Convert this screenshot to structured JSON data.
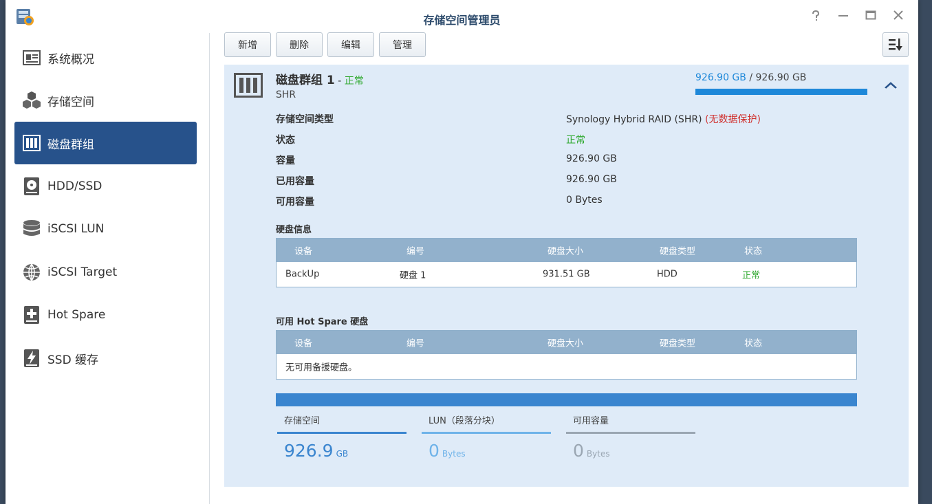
{
  "window": {
    "title": "存储空间管理员",
    "help_icon": "help-icon",
    "minimize_icon": "minimize-icon",
    "maximize_icon": "maximize-icon",
    "close_icon": "close-icon"
  },
  "sidebar": {
    "items": [
      {
        "label": "系统概况",
        "icon": "overview-icon"
      },
      {
        "label": "存储空间",
        "icon": "volume-cubes-icon"
      },
      {
        "label": "磁盘群组",
        "icon": "disk-group-icon",
        "active": true
      },
      {
        "label": "HDD/SSD",
        "icon": "hdd-icon"
      },
      {
        "label": "iSCSI LUN",
        "icon": "database-icon"
      },
      {
        "label": "iSCSI Target",
        "icon": "globe-icon"
      },
      {
        "label": "Hot Spare",
        "icon": "hot-spare-plus-icon"
      },
      {
        "label": "SSD 缓存",
        "icon": "ssd-cache-bolt-icon"
      }
    ]
  },
  "toolbar": {
    "create": "新增",
    "delete": "删除",
    "edit": "编辑",
    "manage": "管理",
    "sort_icon": "sort-icon"
  },
  "group": {
    "name": "磁盘群组 1",
    "dash": " - ",
    "status": "正常",
    "type_short": "SHR",
    "usage_used": "926.90 GB",
    "usage_sep": " / ",
    "usage_total": "926.90 GB",
    "usage_fraction": 1.0,
    "details": [
      {
        "label": "存储空间类型",
        "value": "Synology Hybrid RAID (SHR)",
        "note": " (无数据保护)"
      },
      {
        "label": "状态",
        "value": "正常"
      },
      {
        "label": "容量",
        "value": "926.90 GB"
      },
      {
        "label": "已用容量",
        "value": "926.90 GB"
      },
      {
        "label": "可用容量",
        "value": "0 Bytes"
      }
    ],
    "disk_info_title": "硬盘信息",
    "columns": [
      "设备",
      "编号",
      "硬盘大小",
      "硬盘类型",
      "状态"
    ],
    "disks": [
      {
        "device": "BackUp",
        "number": "硬盘 1",
        "size": "931.51 GB",
        "type": "HDD",
        "status": "正常"
      }
    ],
    "hotspare_title_prefix": "可用 ",
    "hotspare_title_bold": "Hot Spare",
    "hotspare_title_suffix": " 硬盘",
    "hotspare_empty": "无可用备援硬盘。",
    "stats": [
      {
        "label": "存储空间",
        "value": "926.9",
        "unit": "GB",
        "color": "#3a85cf"
      },
      {
        "label": "LUN（段落分块）",
        "value": "0",
        "unit": "Bytes",
        "color": "#6fb3e9"
      },
      {
        "label": "可用容量",
        "value": "0",
        "unit": "Bytes",
        "color": "#9aa6b2"
      }
    ]
  },
  "colors": {
    "accent": "#27528b",
    "usage": "#1e88d9",
    "panel_bg": "#dfebf8",
    "ok": "#2ea82e",
    "warn": "#d0302e"
  }
}
